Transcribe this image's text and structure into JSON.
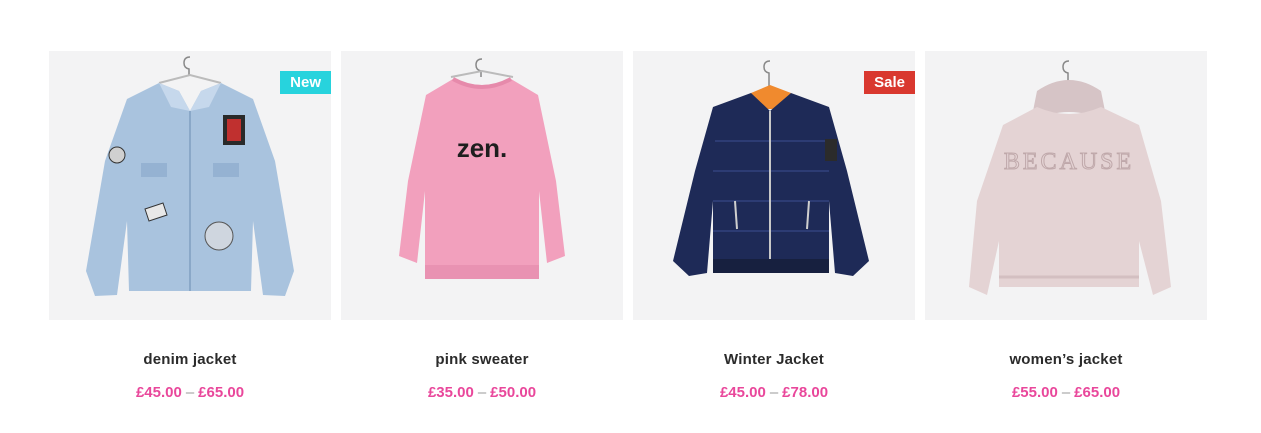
{
  "products": [
    {
      "name": "denim jacket",
      "price_min": "£45.00",
      "price_max": "£65.00",
      "badge": "New",
      "badge_color": "#27d3dd",
      "image": "denim-jacket-image"
    },
    {
      "name": "pink sweater",
      "price_min": "£35.00",
      "price_max": "£50.00",
      "badge": "",
      "image": "pink-sweater-image",
      "print": "zen."
    },
    {
      "name": "Winter Jacket",
      "price_min": "£45.00",
      "price_max": "£78.00",
      "badge": "Sale",
      "badge_color": "#d9382f",
      "image": "winter-jacket-image"
    },
    {
      "name": "women’s jacket",
      "price_min": "£55.00",
      "price_max": "£65.00",
      "badge": "",
      "image": "womens-jacket-image",
      "print": "BECAUSE"
    }
  ],
  "price_separator": "–",
  "colors": {
    "price": "#e9479b",
    "title": "#2b2b2b",
    "image_bg": "#f3f3f4"
  }
}
